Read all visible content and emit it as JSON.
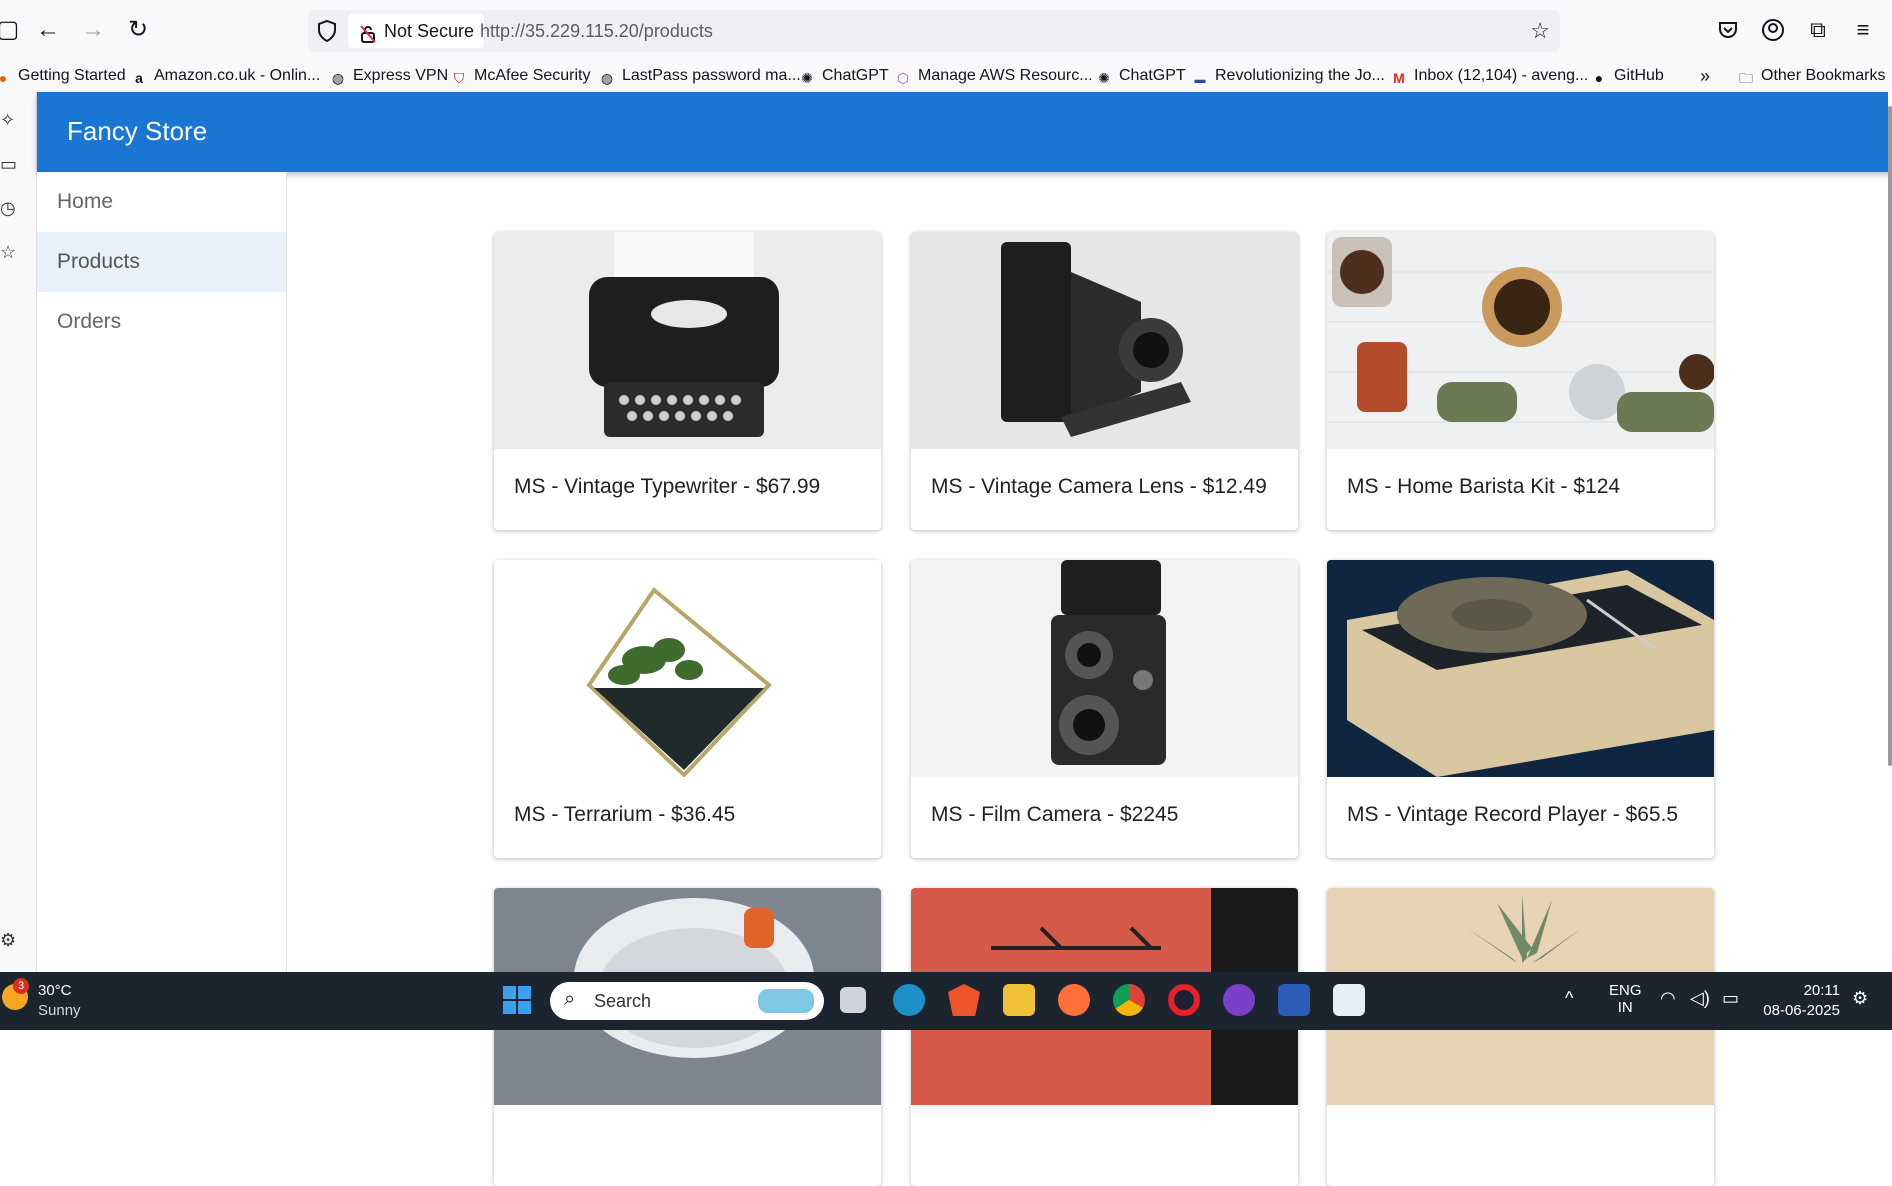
{
  "browser": {
    "security_label": "Not Secure",
    "url": "http://35.229.115.20/products",
    "bookmarks": [
      {
        "label": "Getting Started"
      },
      {
        "label": "Amazon.co.uk - Onlin..."
      },
      {
        "label": "Express VPN"
      },
      {
        "label": "McAfee Security"
      },
      {
        "label": "LastPass password ma..."
      },
      {
        "label": "ChatGPT"
      },
      {
        "label": "Manage AWS Resourc..."
      },
      {
        "label": "ChatGPT"
      },
      {
        "label": "Revolutionizing the Jo..."
      },
      {
        "label": "Inbox (12,104) - aveng..."
      },
      {
        "label": "GitHub"
      }
    ],
    "other_bookmarks": "Other Bookmarks"
  },
  "app": {
    "title": "Fancy Store",
    "nav": [
      {
        "label": "Home"
      },
      {
        "label": "Products"
      },
      {
        "label": "Orders"
      }
    ]
  },
  "products": [
    {
      "title": "MS - Vintage Typewriter - $67.99"
    },
    {
      "title": "MS - Vintage Camera Lens - $12.49"
    },
    {
      "title": "MS - Home Barista Kit - $124"
    },
    {
      "title": "MS - Terrarium - $36.45"
    },
    {
      "title": "MS - Film Camera - $2245"
    },
    {
      "title": "MS - Vintage Record Player - $65.5"
    },
    {
      "title": ""
    },
    {
      "title": ""
    },
    {
      "title": ""
    }
  ],
  "taskbar": {
    "weather_badge": "3",
    "temperature": "30°C",
    "condition": "Sunny",
    "search_label": "Search",
    "lang_line1": "ENG",
    "lang_line2": "IN",
    "time": "20:11",
    "date": "08-06-2025"
  }
}
